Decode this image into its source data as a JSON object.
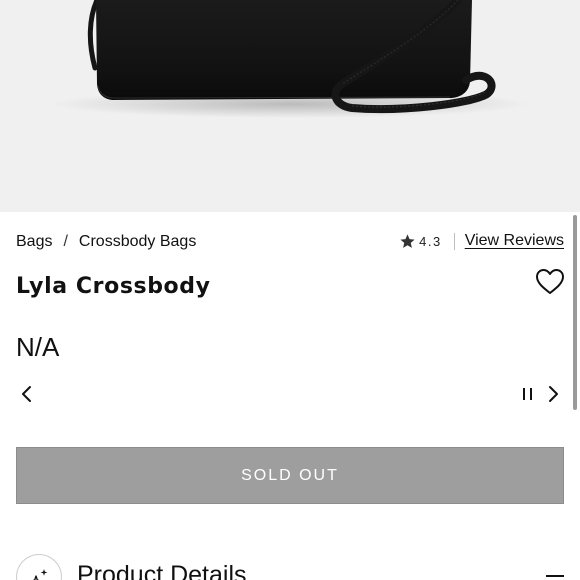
{
  "hero": {
    "alt": "black leather crossbody bag with strap"
  },
  "breadcrumb": {
    "items": [
      {
        "label": "Bags"
      },
      {
        "label": "Crossbody Bags"
      }
    ],
    "separator": "/"
  },
  "rating": {
    "score": "4.3",
    "link_label": "View Reviews"
  },
  "product": {
    "name": "Lyla Crossbody",
    "price": "N/A"
  },
  "carousel": {
    "controls": [
      "chevron-left-icon",
      "pause-icon",
      "chevron-right-icon"
    ]
  },
  "cta": {
    "label": "SOLD OUT"
  },
  "details": {
    "title": "Product Details",
    "icon": "sparkle-icon"
  },
  "colors": {
    "button_gray": "#9e9e9e",
    "hero_bg": "#f0f0f1",
    "text": "#111111"
  }
}
